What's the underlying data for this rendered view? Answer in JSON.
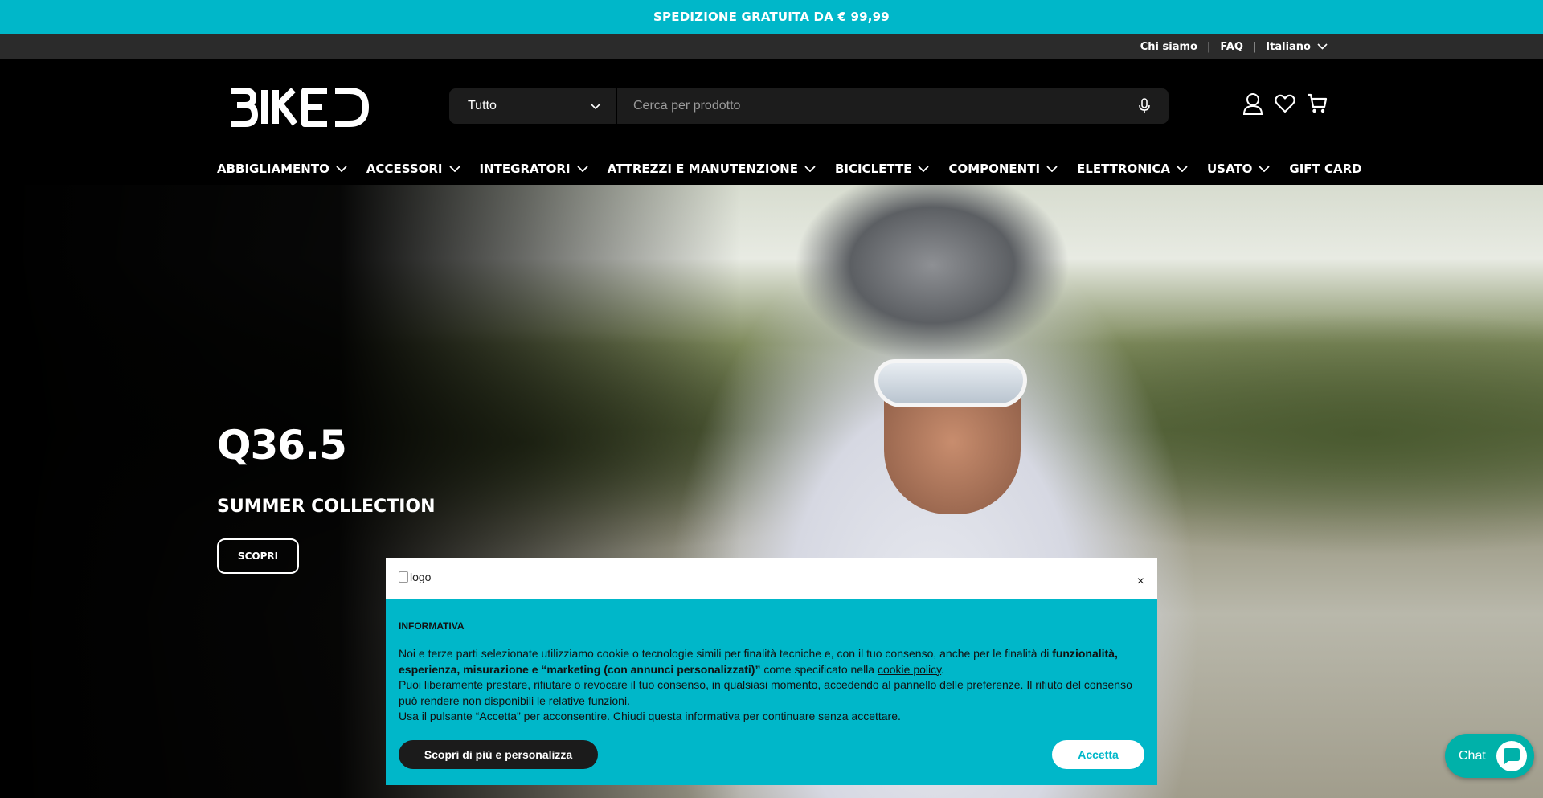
{
  "promo": {
    "text": "SPEDIZIONE GRATUITA DA € 99,99"
  },
  "utility": {
    "about": "Chi siamo",
    "faq": "FAQ",
    "language": "Italiano",
    "separator": "|"
  },
  "header": {
    "logo_text": "BIKED",
    "search": {
      "category": "Tutto",
      "placeholder": "Cerca per prodotto"
    },
    "icons": [
      "user-icon",
      "heart-icon",
      "cart-icon",
      "mic-icon"
    ]
  },
  "nav": {
    "items": [
      {
        "label": "ABBIGLIAMENTO"
      },
      {
        "label": "ACCESSORI"
      },
      {
        "label": "INTEGRATORI"
      },
      {
        "label": "ATTREZZI E MANUTENZIONE"
      },
      {
        "label": "BICICLETTE"
      },
      {
        "label": "COMPONENTI"
      },
      {
        "label": "ELETTRONICA"
      },
      {
        "label": "USATO"
      },
      {
        "label": "GIFT CARD"
      }
    ]
  },
  "hero": {
    "title": "Q36.5",
    "subtitle": "SUMMER COLLECTION",
    "cta": "SCOPRI"
  },
  "cookie": {
    "logo_alt": "logo",
    "close": "×",
    "heading": "INFORMATIVA",
    "p1_a": "Noi e terze parti selezionate utilizziamo cookie o tecnologie simili per finalità tecniche e, con il tuo consenso, anche per le finalità di ",
    "p1_bold": "funzionalità, esperienza, misurazione e “marketing (con annunci personalizzati)”",
    "p1_b": " come specificato nella ",
    "p1_link": "cookie policy",
    "p1_c": ".",
    "p2": "Puoi liberamente prestare, rifiutare o revocare il tuo consenso, in qualsiasi momento, accedendo al pannello delle preferenze. Il rifiuto del consenso può rendere non disponibili le relative funzioni.",
    "p3": "Usa il pulsante “Accetta” per acconsentire. Chiudi questa informativa per continuare senza accettare.",
    "btn_more": "Scopri di più e personalizza",
    "btn_accept": "Accetta"
  },
  "chat": {
    "label": "Chat"
  },
  "colors": {
    "accent": "#00b7c9",
    "chat": "#00b1a9",
    "utility_bar": "#2b2b2b",
    "header": "#000000"
  }
}
